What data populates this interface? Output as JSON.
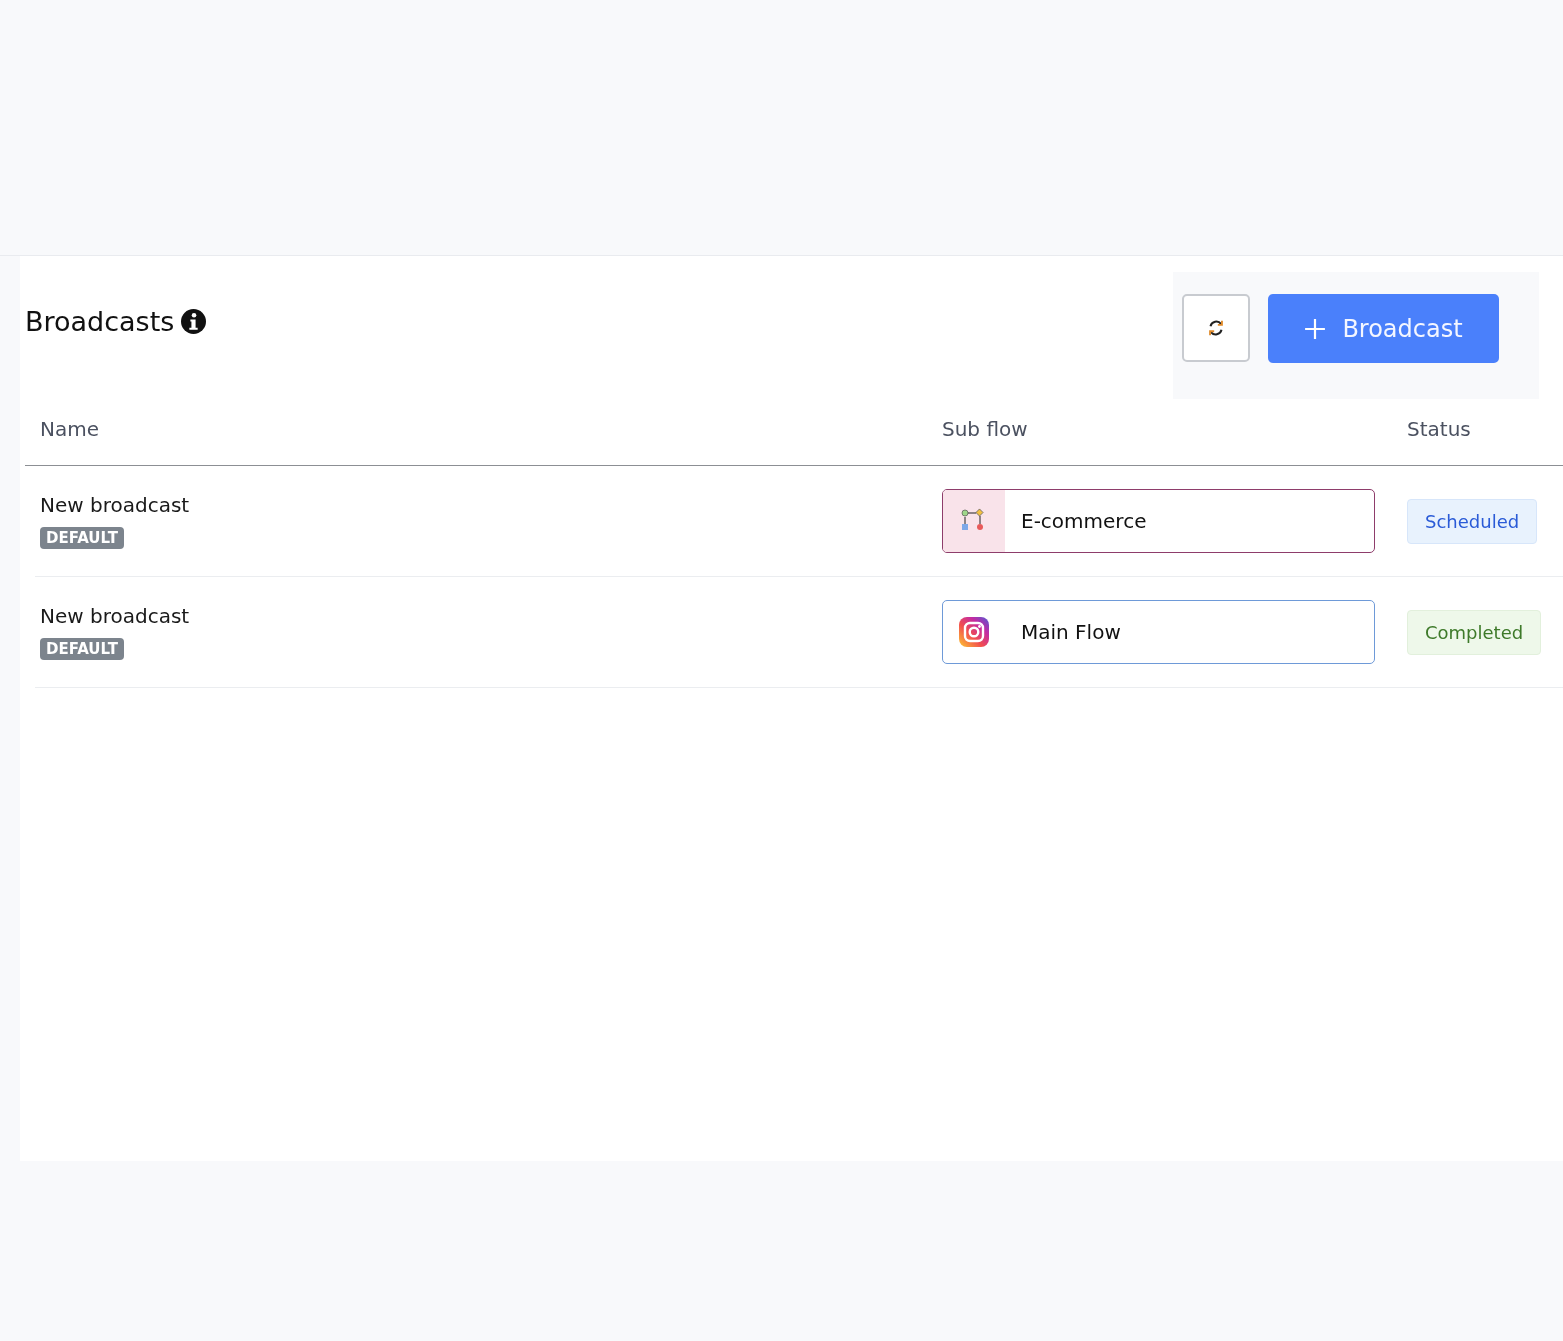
{
  "header": {
    "title": "Broadcasts",
    "new_button": "Broadcast"
  },
  "table": {
    "columns": [
      "Name",
      "Sub flow",
      "Status"
    ],
    "rows": [
      {
        "name": "New broadcast",
        "badge": "DEFAULT",
        "subflow": {
          "kind": "diagram",
          "label": "E-commerce"
        },
        "status": {
          "kind": "scheduled",
          "label": "Scheduled"
        }
      },
      {
        "name": "New broadcast",
        "badge": "DEFAULT",
        "subflow": {
          "kind": "instagram",
          "label": "Main Flow"
        },
        "status": {
          "kind": "completed",
          "label": "Completed"
        }
      }
    ]
  }
}
